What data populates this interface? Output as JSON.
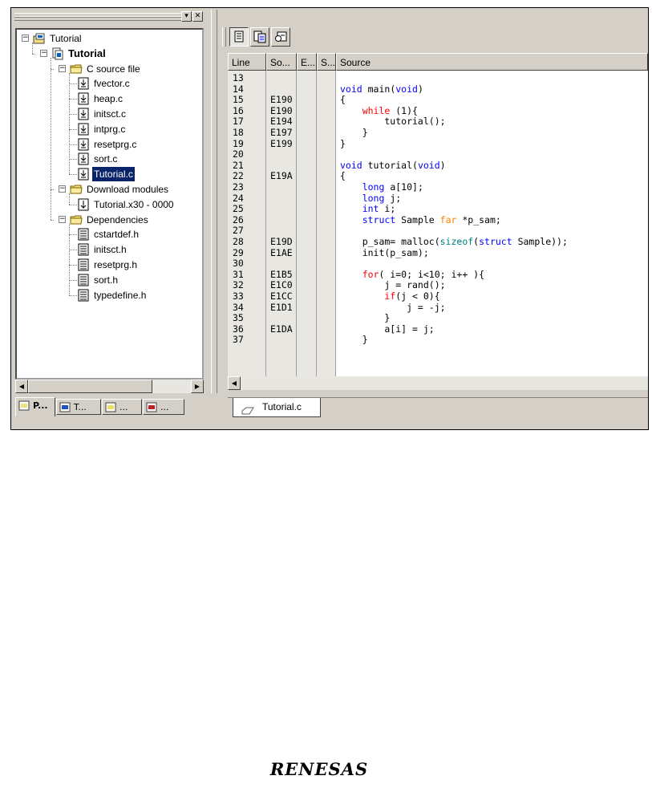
{
  "workspace": {
    "tree": [
      {
        "label": "Tutorial",
        "depth": 0,
        "expanded": true,
        "icon": "workspace-icon"
      },
      {
        "label": "Tutorial",
        "depth": 1,
        "expanded": true,
        "bold": true,
        "icon": "project-icon"
      },
      {
        "label": "C source file",
        "depth": 2,
        "expanded": true,
        "icon": "folder-icon"
      },
      {
        "label": "fvector.c",
        "depth": 3,
        "icon": "c-file-icon"
      },
      {
        "label": "heap.c",
        "depth": 3,
        "icon": "c-file-icon"
      },
      {
        "label": "initsct.c",
        "depth": 3,
        "icon": "c-file-icon"
      },
      {
        "label": "intprg.c",
        "depth": 3,
        "icon": "c-file-icon"
      },
      {
        "label": "resetprg.c",
        "depth": 3,
        "icon": "c-file-icon"
      },
      {
        "label": "sort.c",
        "depth": 3,
        "icon": "c-file-icon"
      },
      {
        "label": "Tutorial.c",
        "depth": 3,
        "icon": "c-file-icon",
        "selected": true
      },
      {
        "label": "Download modules",
        "depth": 2,
        "expanded": true,
        "icon": "folder-icon"
      },
      {
        "label": "Tutorial.x30 - 0000",
        "depth": 3,
        "icon": "download-module-icon"
      },
      {
        "label": "Dependencies",
        "depth": 2,
        "expanded": true,
        "icon": "folder-icon"
      },
      {
        "label": "cstartdef.h",
        "depth": 3,
        "icon": "header-file-icon"
      },
      {
        "label": "initsct.h",
        "depth": 3,
        "icon": "header-file-icon"
      },
      {
        "label": "resetprg.h",
        "depth": 3,
        "icon": "header-file-icon"
      },
      {
        "label": "sort.h",
        "depth": 3,
        "icon": "header-file-icon"
      },
      {
        "label": "typedefine.h",
        "depth": 3,
        "icon": "header-file-icon"
      }
    ],
    "tabs": [
      {
        "label": "P...",
        "icon": "projects-tab-icon",
        "active": true
      },
      {
        "label": "T...",
        "icon": "templates-tab-icon"
      },
      {
        "label": "...",
        "icon": "navigation-tab-icon"
      },
      {
        "label": "...",
        "icon": "test-tab-icon"
      }
    ]
  },
  "editor": {
    "columns": [
      "Line",
      "So...",
      "E...",
      "S...",
      "Source"
    ],
    "rows": [
      {
        "line": "13",
        "addr": "",
        "src": [
          [
            "",
            ""
          ]
        ]
      },
      {
        "line": "14",
        "addr": "",
        "src": [
          [
            "kw",
            "void"
          ],
          [
            "",
            " main("
          ],
          [
            "kw",
            "void"
          ],
          [
            "",
            ")"
          ]
        ]
      },
      {
        "line": "15",
        "addr": "E190",
        "src": [
          [
            "",
            "{"
          ]
        ]
      },
      {
        "line": "16",
        "addr": "E190",
        "src": [
          [
            "",
            "    "
          ],
          [
            "ctl",
            "while"
          ],
          [
            "",
            " (1){"
          ]
        ]
      },
      {
        "line": "17",
        "addr": "E194",
        "src": [
          [
            "",
            "        tutorial();"
          ]
        ]
      },
      {
        "line": "18",
        "addr": "E197",
        "src": [
          [
            "",
            "    }"
          ]
        ]
      },
      {
        "line": "19",
        "addr": "E199",
        "src": [
          [
            "",
            "}"
          ]
        ]
      },
      {
        "line": "20",
        "addr": "",
        "src": [
          [
            "",
            ""
          ]
        ]
      },
      {
        "line": "21",
        "addr": "",
        "src": [
          [
            "kw",
            "void"
          ],
          [
            "",
            " tutorial("
          ],
          [
            "kw",
            "void"
          ],
          [
            "",
            ")"
          ]
        ]
      },
      {
        "line": "22",
        "addr": "E19A",
        "src": [
          [
            "",
            "{"
          ]
        ]
      },
      {
        "line": "23",
        "addr": "",
        "src": [
          [
            "",
            "    "
          ],
          [
            "kw",
            "long"
          ],
          [
            "",
            " a[10];"
          ]
        ]
      },
      {
        "line": "24",
        "addr": "",
        "src": [
          [
            "",
            "    "
          ],
          [
            "kw",
            "long"
          ],
          [
            "",
            " j;"
          ]
        ]
      },
      {
        "line": "25",
        "addr": "",
        "src": [
          [
            "",
            "    "
          ],
          [
            "kw",
            "int"
          ],
          [
            "",
            " i;"
          ]
        ]
      },
      {
        "line": "26",
        "addr": "",
        "src": [
          [
            "",
            "    "
          ],
          [
            "kw",
            "struct"
          ],
          [
            "",
            " Sample "
          ],
          [
            "far",
            "far"
          ],
          [
            "",
            " *p_sam;"
          ]
        ]
      },
      {
        "line": "27",
        "addr": "",
        "src": [
          [
            "",
            ""
          ]
        ]
      },
      {
        "line": "28",
        "addr": "E19D",
        "src": [
          [
            "",
            "    p_sam= malloc("
          ],
          [
            "fn",
            "sizeof"
          ],
          [
            "",
            "("
          ],
          [
            "kw",
            "struct"
          ],
          [
            "",
            " Sample));"
          ]
        ]
      },
      {
        "line": "29",
        "addr": "E1AE",
        "src": [
          [
            "",
            "    init(p_sam);"
          ]
        ]
      },
      {
        "line": "30",
        "addr": "",
        "src": [
          [
            "",
            ""
          ]
        ]
      },
      {
        "line": "31",
        "addr": "E1B5",
        "src": [
          [
            "",
            "    "
          ],
          [
            "ctl",
            "for"
          ],
          [
            "",
            "( i=0; i<10; i++ ){"
          ]
        ]
      },
      {
        "line": "32",
        "addr": "E1C0",
        "src": [
          [
            "",
            "        j = rand();"
          ]
        ]
      },
      {
        "line": "33",
        "addr": "E1CC",
        "src": [
          [
            "",
            "        "
          ],
          [
            "ctl",
            "if"
          ],
          [
            "",
            "(j < 0){"
          ]
        ]
      },
      {
        "line": "34",
        "addr": "E1D1",
        "src": [
          [
            "",
            "            j = -j;"
          ]
        ]
      },
      {
        "line": "35",
        "addr": "",
        "src": [
          [
            "",
            "        }"
          ]
        ]
      },
      {
        "line": "36",
        "addr": "E1DA",
        "src": [
          [
            "",
            "        a[i] = j;"
          ]
        ]
      },
      {
        "line": "37",
        "addr": "",
        "src": [
          [
            "",
            "    }"
          ]
        ]
      }
    ],
    "doc_tab": "Tutorial.c",
    "colors": {
      "keyword": "#0000ff",
      "control": "#ff0000",
      "function": "#008080",
      "qualifier": "#ff8000",
      "selection": "#0a246a"
    }
  },
  "footer": {
    "logo_text": "RENESAS"
  }
}
